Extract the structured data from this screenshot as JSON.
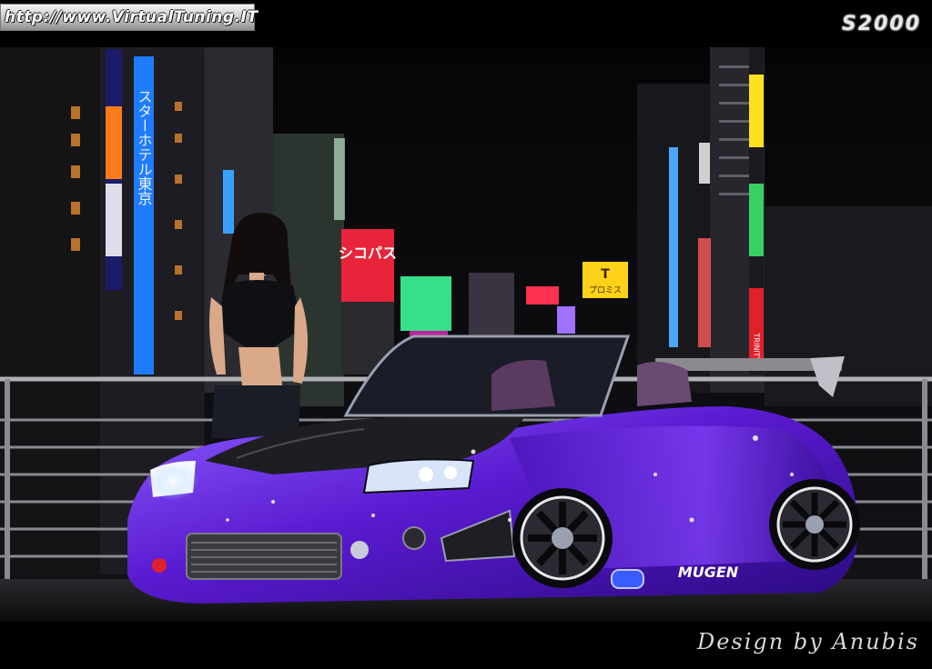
{
  "header": {
    "url_text": "http://www.VirtualTuning.IT",
    "model_logo": "S2000"
  },
  "footer": {
    "credit": "Design by Anubis"
  },
  "scene": {
    "signs": {
      "vertical_blue": "スターホテル東京",
      "billboard_red": "シコパス",
      "sign_yellow_logo": "T",
      "sign_yellow_text": "プロミス",
      "right_tower": "TRINITY"
    },
    "car_plate": "MUGEN",
    "colors": {
      "sky": "#0a0a0c",
      "car_body": "#6a1fd6",
      "car_highlight": "#a070ff",
      "neon_blue": "#2f8cff",
      "neon_red": "#e0202a",
      "neon_yellow": "#ffd21a",
      "ground": "#1a1a1c"
    }
  }
}
